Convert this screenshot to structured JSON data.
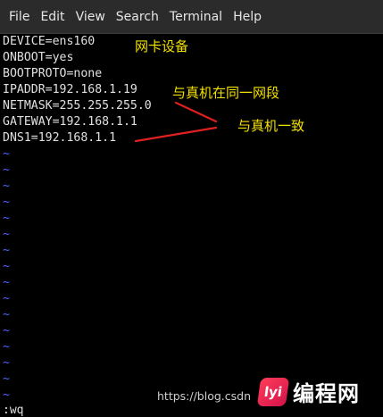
{
  "menubar": {
    "items": [
      "File",
      "Edit",
      "View",
      "Search",
      "Terminal",
      "Help"
    ]
  },
  "editor": {
    "lines": [
      "DEVICE=ens160",
      "ONBOOT=yes",
      "BOOTPROTO=none",
      "IPADDR=192.168.1.19",
      "NETMASK=255.255.255.0",
      "GATEWAY=192.168.1.1",
      "DNS1=192.168.1.1"
    ],
    "tilde": "~",
    "command": ":wq"
  },
  "annotations": {
    "device": "网卡设备",
    "same_subnet": "与真机在同一网段",
    "consistent": "与真机一致",
    "color": "#f2e000",
    "arrow_color": "#e02020"
  },
  "watermark": {
    "url": "https://blog.csdn",
    "logo_mark": "lyi",
    "logo_text": "编程网"
  }
}
